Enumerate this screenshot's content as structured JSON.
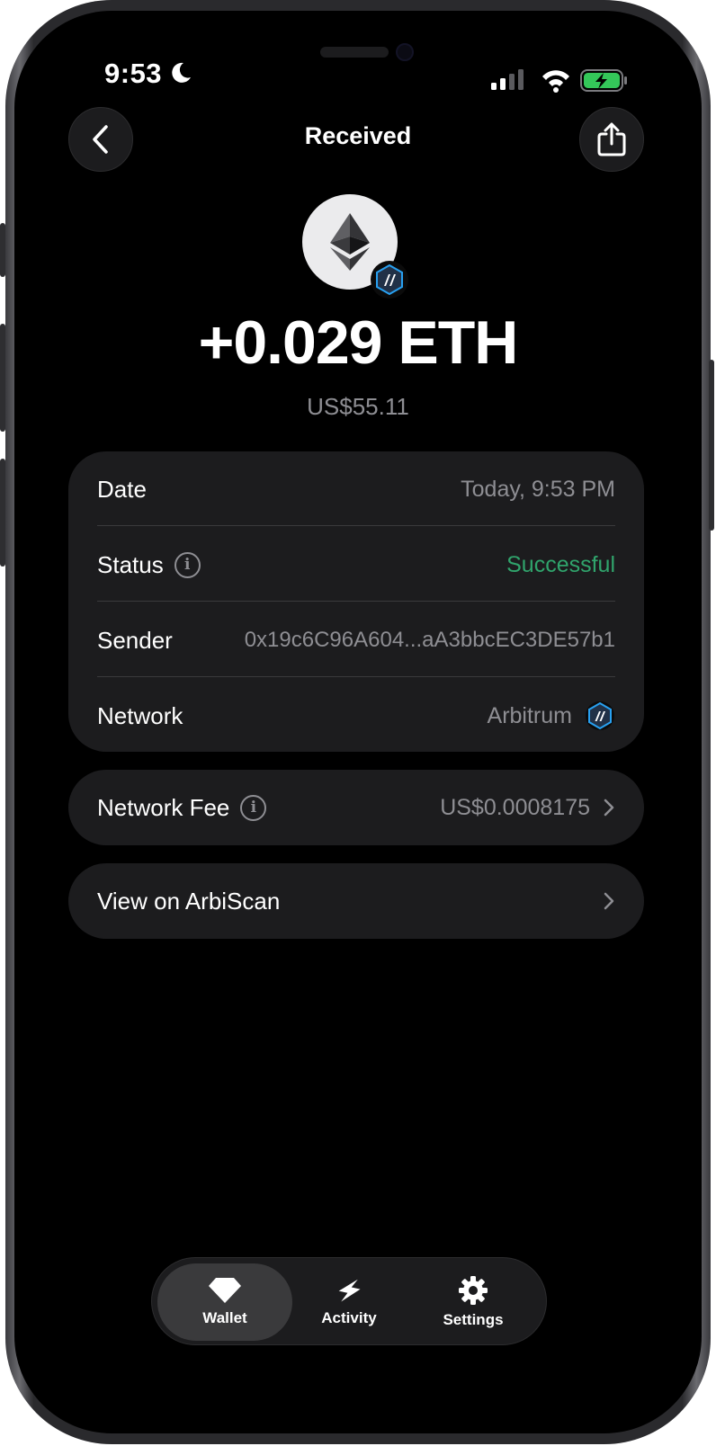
{
  "status_bar": {
    "time": "9:53"
  },
  "header": {
    "title": "Received"
  },
  "transaction": {
    "amount": "+0.029 ETH",
    "fiat_value": "US$55.11"
  },
  "details": {
    "date_label": "Date",
    "date_value": "Today, 9:53 PM",
    "status_label": "Status",
    "status_value": "Successful",
    "sender_label": "Sender",
    "sender_value": "0x19c6C96A604...aA3bbcEC3DE57b1",
    "network_label": "Network",
    "network_value": "Arbitrum"
  },
  "fee": {
    "label": "Network Fee",
    "value": "US$0.0008175"
  },
  "explorer": {
    "label": "View on ArbiScan"
  },
  "tabs": [
    {
      "label": "Wallet",
      "icon": "gem-icon",
      "active": true
    },
    {
      "label": "Activity",
      "icon": "bolt-icon",
      "active": false
    },
    {
      "label": "Settings",
      "icon": "gear-icon",
      "active": false
    }
  ],
  "colors": {
    "success": "#30a46c",
    "card": "#1c1c1e",
    "secondary_text": "#8e8e93",
    "arbitrum_blue": "#28a0f0"
  }
}
